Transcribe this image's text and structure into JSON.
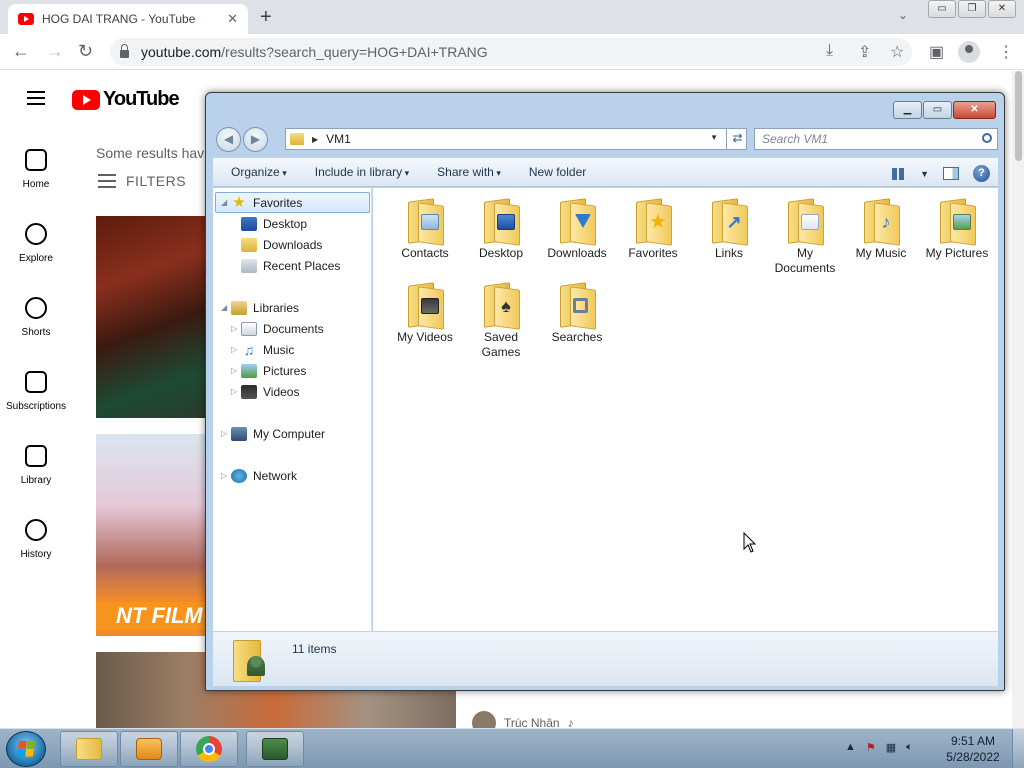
{
  "browser": {
    "tab_title": "HOG DAI TRANG - YouTube",
    "tab_close": "✕",
    "new_tab": "+",
    "url_domain": "youtube.com",
    "url_path": "/results?search_query=HOG+DAI+TRANG",
    "win_minimize": "▭",
    "win_restore": "❐",
    "win_close": "✕"
  },
  "youtube": {
    "logo_text": "YouTube",
    "sidebar": [
      {
        "label": "Home",
        "icon": "home-icon"
      },
      {
        "label": "Explore",
        "icon": "compass-icon"
      },
      {
        "label": "Shorts",
        "icon": "shorts-icon"
      },
      {
        "label": "Subscriptions",
        "icon": "subscriptions-icon"
      },
      {
        "label": "Library",
        "icon": "library-icon"
      },
      {
        "label": "History",
        "icon": "history-icon"
      }
    ],
    "results_note": "Some results hav",
    "filters_label": "FILTERS",
    "thumb2_badge": "NT FILM",
    "channel_name": "Trúc Nhân",
    "channel_note": "♪"
  },
  "explorer": {
    "address": "VM1",
    "search_placeholder": "Search VM1",
    "commands": [
      "Organize",
      "Include in library",
      "Share with",
      "New folder"
    ],
    "nav": {
      "favorites": "Favorites",
      "desktop": "Desktop",
      "downloads": "Downloads",
      "recent_places": "Recent Places",
      "libraries": "Libraries",
      "documents": "Documents",
      "music": "Music",
      "pictures": "Pictures",
      "videos": "Videos",
      "my_computer": "My Computer",
      "network": "Network"
    },
    "items": [
      {
        "label": "Contacts",
        "emblem": "contacts"
      },
      {
        "label": "Desktop",
        "emblem": "desktop"
      },
      {
        "label": "Downloads",
        "emblem": "downloads"
      },
      {
        "label": "Favorites",
        "emblem": "favorites"
      },
      {
        "label": "Links",
        "emblem": "links"
      },
      {
        "label": "My Documents",
        "emblem": "documents"
      },
      {
        "label": "My Music",
        "emblem": "music"
      },
      {
        "label": "My Pictures",
        "emblem": "pictures"
      },
      {
        "label": "My Videos",
        "emblem": "videos"
      },
      {
        "label": "Saved Games",
        "emblem": "games"
      },
      {
        "label": "Searches",
        "emblem": "searches"
      }
    ],
    "item_count": "11 items"
  },
  "taskbar": {
    "time": "9:51 AM",
    "date": "5/28/2022"
  },
  "colors": {
    "yt_red": "#ff0000",
    "explorer_frame": "#b9d1ea",
    "taskbar": "#8ea6be"
  }
}
